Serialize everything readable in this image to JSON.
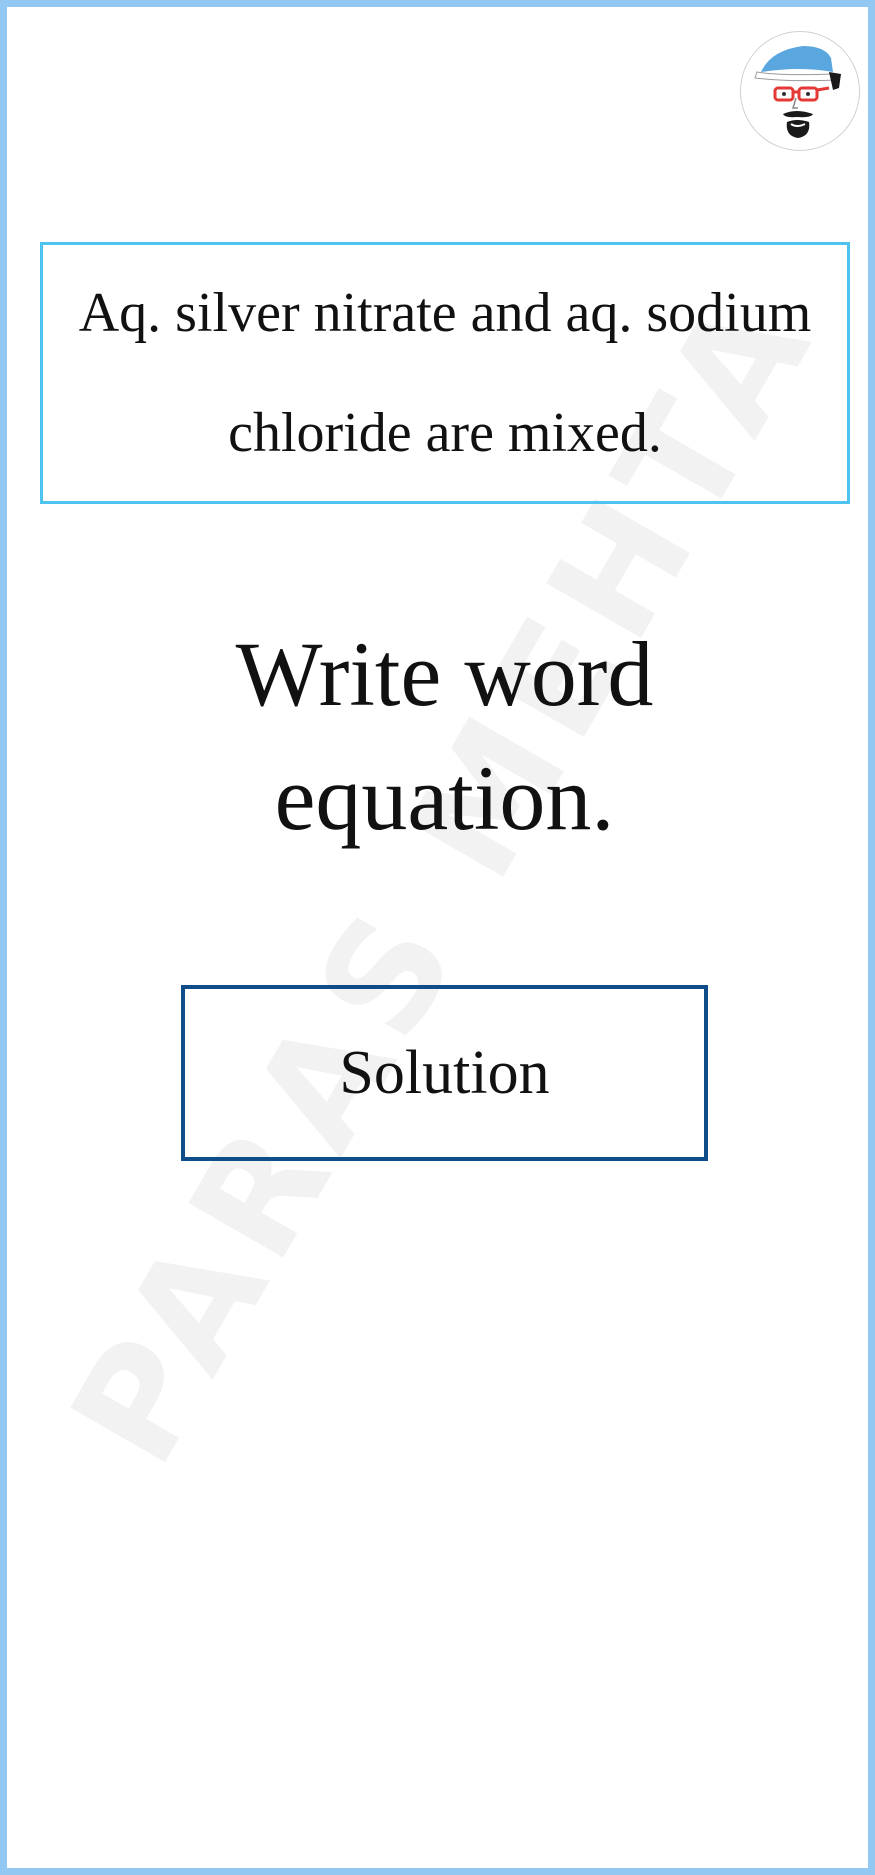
{
  "watermark": {
    "text": "PARAS MEHTA"
  },
  "avatar": {
    "icon": "cartoon-face-avatar-icon"
  },
  "question": {
    "text": "Aq. silver nitrate and aq. sodium chloride are mixed."
  },
  "prompt": {
    "text": "Write word equation."
  },
  "solution_button": {
    "label": "Solution"
  },
  "colors": {
    "frame_border": "#93c8f2",
    "question_border": "#4fc3f0",
    "button_border": "#0f4d8a",
    "text": "#111111"
  }
}
